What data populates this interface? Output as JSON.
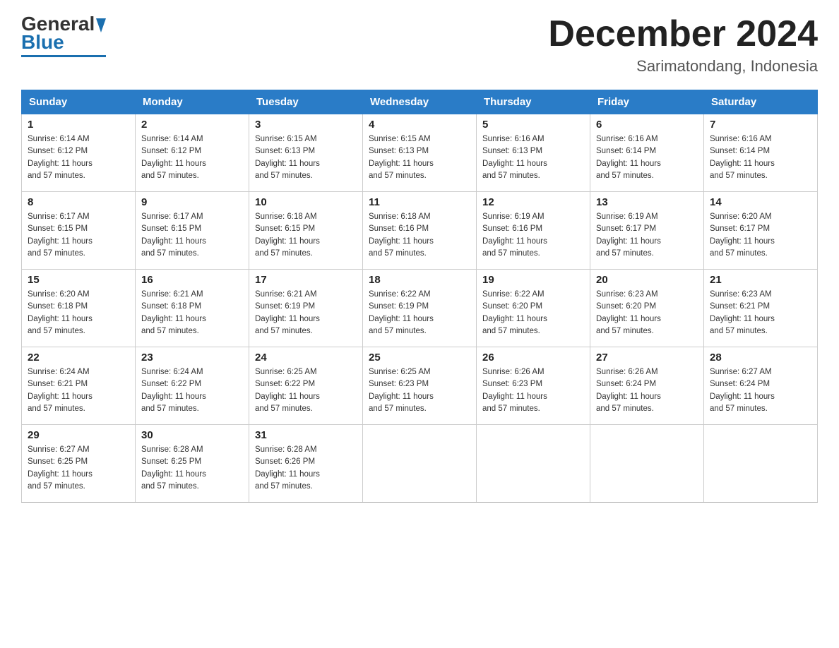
{
  "header": {
    "logo_general": "General",
    "logo_blue": "Blue",
    "month_title": "December 2024",
    "location": "Sarimatondang, Indonesia"
  },
  "days_of_week": [
    "Sunday",
    "Monday",
    "Tuesday",
    "Wednesday",
    "Thursday",
    "Friday",
    "Saturday"
  ],
  "weeks": [
    [
      {
        "day": "1",
        "sunrise": "6:14 AM",
        "sunset": "6:12 PM",
        "daylight": "11 hours and 57 minutes."
      },
      {
        "day": "2",
        "sunrise": "6:14 AM",
        "sunset": "6:12 PM",
        "daylight": "11 hours and 57 minutes."
      },
      {
        "day": "3",
        "sunrise": "6:15 AM",
        "sunset": "6:13 PM",
        "daylight": "11 hours and 57 minutes."
      },
      {
        "day": "4",
        "sunrise": "6:15 AM",
        "sunset": "6:13 PM",
        "daylight": "11 hours and 57 minutes."
      },
      {
        "day": "5",
        "sunrise": "6:16 AM",
        "sunset": "6:13 PM",
        "daylight": "11 hours and 57 minutes."
      },
      {
        "day": "6",
        "sunrise": "6:16 AM",
        "sunset": "6:14 PM",
        "daylight": "11 hours and 57 minutes."
      },
      {
        "day": "7",
        "sunrise": "6:16 AM",
        "sunset": "6:14 PM",
        "daylight": "11 hours and 57 minutes."
      }
    ],
    [
      {
        "day": "8",
        "sunrise": "6:17 AM",
        "sunset": "6:15 PM",
        "daylight": "11 hours and 57 minutes."
      },
      {
        "day": "9",
        "sunrise": "6:17 AM",
        "sunset": "6:15 PM",
        "daylight": "11 hours and 57 minutes."
      },
      {
        "day": "10",
        "sunrise": "6:18 AM",
        "sunset": "6:15 PM",
        "daylight": "11 hours and 57 minutes."
      },
      {
        "day": "11",
        "sunrise": "6:18 AM",
        "sunset": "6:16 PM",
        "daylight": "11 hours and 57 minutes."
      },
      {
        "day": "12",
        "sunrise": "6:19 AM",
        "sunset": "6:16 PM",
        "daylight": "11 hours and 57 minutes."
      },
      {
        "day": "13",
        "sunrise": "6:19 AM",
        "sunset": "6:17 PM",
        "daylight": "11 hours and 57 minutes."
      },
      {
        "day": "14",
        "sunrise": "6:20 AM",
        "sunset": "6:17 PM",
        "daylight": "11 hours and 57 minutes."
      }
    ],
    [
      {
        "day": "15",
        "sunrise": "6:20 AM",
        "sunset": "6:18 PM",
        "daylight": "11 hours and 57 minutes."
      },
      {
        "day": "16",
        "sunrise": "6:21 AM",
        "sunset": "6:18 PM",
        "daylight": "11 hours and 57 minutes."
      },
      {
        "day": "17",
        "sunrise": "6:21 AM",
        "sunset": "6:19 PM",
        "daylight": "11 hours and 57 minutes."
      },
      {
        "day": "18",
        "sunrise": "6:22 AM",
        "sunset": "6:19 PM",
        "daylight": "11 hours and 57 minutes."
      },
      {
        "day": "19",
        "sunrise": "6:22 AM",
        "sunset": "6:20 PM",
        "daylight": "11 hours and 57 minutes."
      },
      {
        "day": "20",
        "sunrise": "6:23 AM",
        "sunset": "6:20 PM",
        "daylight": "11 hours and 57 minutes."
      },
      {
        "day": "21",
        "sunrise": "6:23 AM",
        "sunset": "6:21 PM",
        "daylight": "11 hours and 57 minutes."
      }
    ],
    [
      {
        "day": "22",
        "sunrise": "6:24 AM",
        "sunset": "6:21 PM",
        "daylight": "11 hours and 57 minutes."
      },
      {
        "day": "23",
        "sunrise": "6:24 AM",
        "sunset": "6:22 PM",
        "daylight": "11 hours and 57 minutes."
      },
      {
        "day": "24",
        "sunrise": "6:25 AM",
        "sunset": "6:22 PM",
        "daylight": "11 hours and 57 minutes."
      },
      {
        "day": "25",
        "sunrise": "6:25 AM",
        "sunset": "6:23 PM",
        "daylight": "11 hours and 57 minutes."
      },
      {
        "day": "26",
        "sunrise": "6:26 AM",
        "sunset": "6:23 PM",
        "daylight": "11 hours and 57 minutes."
      },
      {
        "day": "27",
        "sunrise": "6:26 AM",
        "sunset": "6:24 PM",
        "daylight": "11 hours and 57 minutes."
      },
      {
        "day": "28",
        "sunrise": "6:27 AM",
        "sunset": "6:24 PM",
        "daylight": "11 hours and 57 minutes."
      }
    ],
    [
      {
        "day": "29",
        "sunrise": "6:27 AM",
        "sunset": "6:25 PM",
        "daylight": "11 hours and 57 minutes."
      },
      {
        "day": "30",
        "sunrise": "6:28 AM",
        "sunset": "6:25 PM",
        "daylight": "11 hours and 57 minutes."
      },
      {
        "day": "31",
        "sunrise": "6:28 AM",
        "sunset": "6:26 PM",
        "daylight": "11 hours and 57 minutes."
      },
      null,
      null,
      null,
      null
    ]
  ],
  "labels": {
    "sunrise_prefix": "Sunrise: ",
    "sunset_prefix": "Sunset: ",
    "daylight_prefix": "Daylight: "
  }
}
